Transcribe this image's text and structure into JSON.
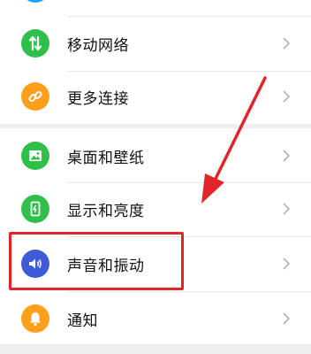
{
  "groups": [
    {
      "items": [
        {
          "label": "",
          "icon": "partial-icon",
          "color": "#1aa3ff"
        },
        {
          "label": "移动网络",
          "icon": "mobile-data-icon",
          "color": "#2fbf4a"
        },
        {
          "label": "更多连接",
          "icon": "link-icon",
          "color": "#ff9f1a"
        }
      ]
    },
    {
      "items": [
        {
          "label": "桌面和壁纸",
          "icon": "wallpaper-icon",
          "color": "#2fbf4a"
        },
        {
          "label": "显示和亮度",
          "icon": "display-brightness-icon",
          "color": "#2fbf4a"
        },
        {
          "label": "声音和振动",
          "icon": "sound-icon",
          "color": "#3f5bd8"
        },
        {
          "label": "通知",
          "icon": "bell-icon",
          "color": "#ff9f1a"
        }
      ]
    }
  ],
  "annotation": {
    "highlight_color": "#e0262b",
    "arrow_color": "#e0262b"
  }
}
